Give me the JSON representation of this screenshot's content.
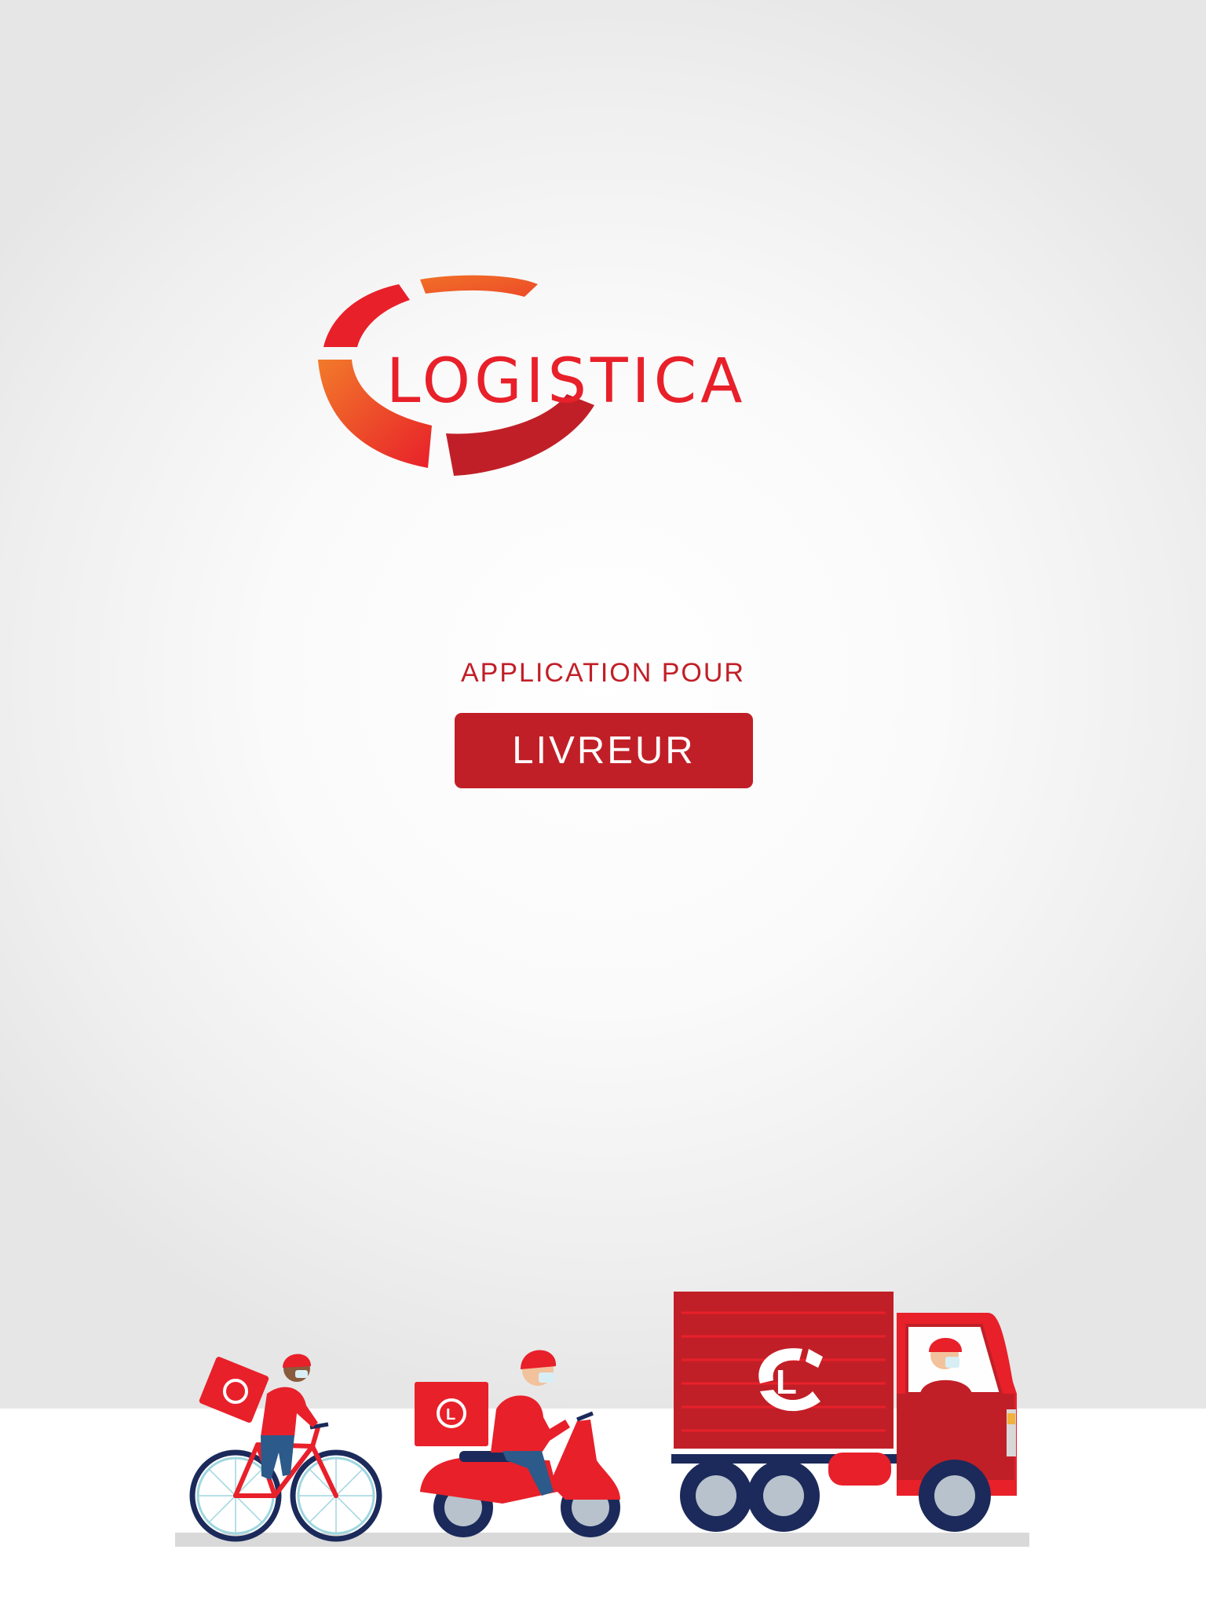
{
  "brand": {
    "name": "LOGISTICA",
    "logo_icon": "logistica-ring-logo",
    "colors": {
      "primary_red": "#c11f27",
      "bright_red": "#e8202a",
      "orange": "#f07028"
    }
  },
  "main": {
    "subtitle": "APPLICATION POUR",
    "role_button_label": "LIVREUR"
  },
  "illustration": {
    "vehicles": [
      "bicycle-courier",
      "scooter-courier",
      "delivery-truck"
    ],
    "badge_letter": "L"
  }
}
